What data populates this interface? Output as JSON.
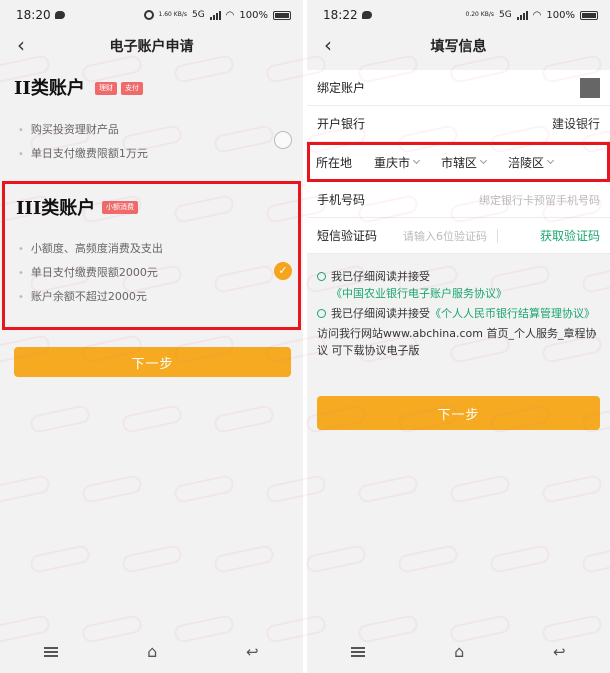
{
  "left": {
    "status_time": "18:20",
    "status_net": "1.60 KB/s",
    "status_sig": "5G",
    "status_battery": "100%",
    "title": "电子账户申请",
    "account2": {
      "title": "II类账户",
      "tags": [
        "理财",
        "支付"
      ],
      "features": [
        "购买投资理财产品",
        "单日支付缴费限额1万元"
      ]
    },
    "account3": {
      "title": "III类账户",
      "tag": "小额消费",
      "features": [
        "小额度、高频度消费及支出",
        "单日支付缴费限额2000元",
        "账户余额不超过2000元"
      ]
    },
    "next_button": "下一步"
  },
  "right": {
    "status_time": "18:22",
    "status_net": "0.20 KB/s",
    "status_sig": "5G",
    "status_battery": "100%",
    "title": "填写信息",
    "bind_account_label": "绑定账户",
    "bank_label": "开户银行",
    "bank_value": "建设银行",
    "location_label": "所在地",
    "location": [
      "重庆市",
      "市辖区",
      "涪陵区"
    ],
    "phone_label": "手机号码",
    "phone_placeholder": "绑定银行卡预留手机号码",
    "sms_label": "短信验证码",
    "sms_placeholder": "请输入6位验证码",
    "sms_button": "获取验证码",
    "agree1_prefix": "我已仔细阅读并接受",
    "agree1_link": "《中国农业银行电子账户服务协议》",
    "agree2_prefix": "我已仔细阅读并接受",
    "agree2_link": "《个人人民币银行结算管理协议》",
    "visit_text": "访问我行网站www.abchina.com 首页_个人服务_章程协议 可下载协议电子版",
    "next_button": "下一步"
  },
  "colors": {
    "accent": "#f6aa22",
    "link": "#1aa56f",
    "highlight": "#e8151c",
    "tag": "#ef6a6a"
  },
  "icons": [
    "back-arrow-icon",
    "message-icon",
    "alarm-icon",
    "signal-icon",
    "wifi-icon",
    "battery-icon",
    "checkmark-icon",
    "chevron-down-icon",
    "menu-key-icon",
    "home-key-icon",
    "back-key-icon"
  ]
}
